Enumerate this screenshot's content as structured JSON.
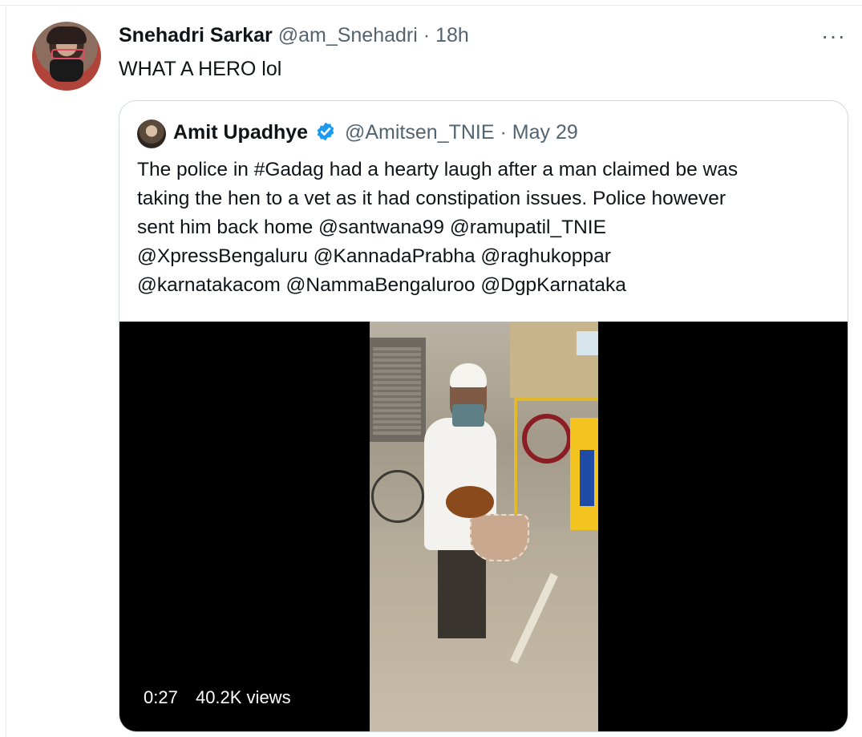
{
  "tweet": {
    "author_name": "Snehadri Sarkar",
    "author_handle": "@am_Snehadri",
    "separator": "·",
    "time": "18h",
    "text": "WHAT A HERO lol",
    "more_icon": "···"
  },
  "quoted_tweet": {
    "author_name": "Amit Upadhye",
    "verified": true,
    "author_handle": "@Amitsen_TNIE",
    "separator": "·",
    "date": "May 29",
    "text_lines": [
      "The police in #Gadag had a hearty laugh after a man claimed be was",
      "taking the hen to a vet as it had constipation issues. Police however",
      "sent him back home @santwana99 @ramupatil_TNIE",
      "@XpressBengaluru @KannadaPrabha @raghukoppar",
      "@karnatakacom @NammaBengaluroo @DgpKarnataka"
    ],
    "video": {
      "duration": "0:27",
      "views": "40.2K views"
    }
  },
  "colors": {
    "verified_blue": "#1d9bf0",
    "muted_text": "#536471",
    "border": "#cfd9de"
  }
}
